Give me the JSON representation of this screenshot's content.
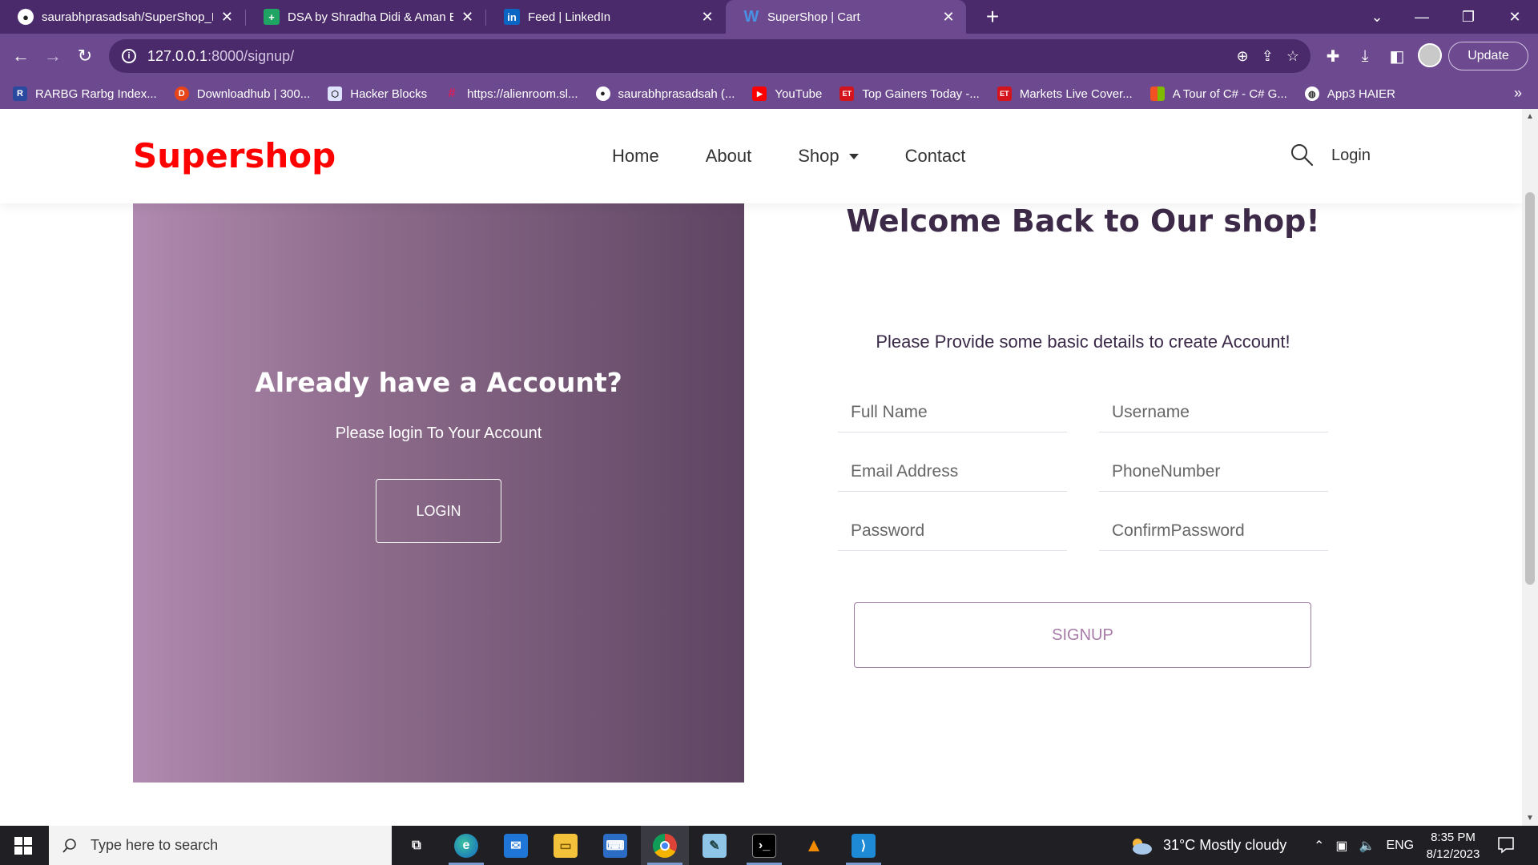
{
  "browser": {
    "tabs": [
      {
        "title": "saurabhprasadsah/SuperShop_D",
        "icon": "github-icon",
        "active": false
      },
      {
        "title": "DSA by Shradha Didi & Aman Bh",
        "icon": "sheets-icon",
        "active": false
      },
      {
        "title": "Feed | LinkedIn",
        "icon": "linkedin-icon",
        "active": false
      },
      {
        "title": "SuperShop | Cart",
        "icon": "w-icon",
        "active": true
      }
    ],
    "url_host": "127.0.0.1",
    "url_path": ":8000/signup/",
    "update_label": "Update",
    "bookmarks": [
      {
        "label": "RARBG Rarbg Index...",
        "icon": "rarbg-icon"
      },
      {
        "label": "Downloadhub | 300...",
        "icon": "downloadhub-icon"
      },
      {
        "label": "Hacker Blocks",
        "icon": "hackerblocks-icon"
      },
      {
        "label": "https://alienroom.sl...",
        "icon": "slack-icon"
      },
      {
        "label": "saurabhprasadsah (...",
        "icon": "github-icon"
      },
      {
        "label": "YouTube",
        "icon": "youtube-icon"
      },
      {
        "label": "Top Gainers Today -...",
        "icon": "et-icon"
      },
      {
        "label": "Markets Live Cover...",
        "icon": "et-icon"
      },
      {
        "label": "A Tour of C# - C# G...",
        "icon": "microsoft-icon"
      },
      {
        "label": "App3 HAIER",
        "icon": "globe-icon"
      }
    ]
  },
  "site": {
    "logo": "Supershop",
    "nav": {
      "home": "Home",
      "about": "About",
      "shop": "Shop",
      "contact": "Contact"
    },
    "login_link": "Login"
  },
  "left_panel": {
    "title": "Already have a Account?",
    "subtitle": "Please login To Your Account",
    "login_button": "LOGIN"
  },
  "form": {
    "welcome": "Welcome Back to Our shop!",
    "instructions": "Please Provide some basic details to create Account!",
    "placeholders": {
      "full_name": "Full Name",
      "username": "Username",
      "email": "Email Address",
      "phone": "PhoneNumber",
      "password": "Password",
      "confirm_password": "ConfirmPassword"
    },
    "signup_button": "SIGNUP"
  },
  "taskbar": {
    "search_placeholder": "Type here to search",
    "weather": "31°C  Mostly cloudy",
    "language": "ENG",
    "time": "8:35 PM",
    "date": "8/12/2023"
  },
  "colors": {
    "brand_red": "#ff0000",
    "panel_start": "#b08ab0",
    "panel_end": "#5e4562",
    "signup_text": "#a77aa7",
    "chrome_purple": "#6d4a8f"
  }
}
